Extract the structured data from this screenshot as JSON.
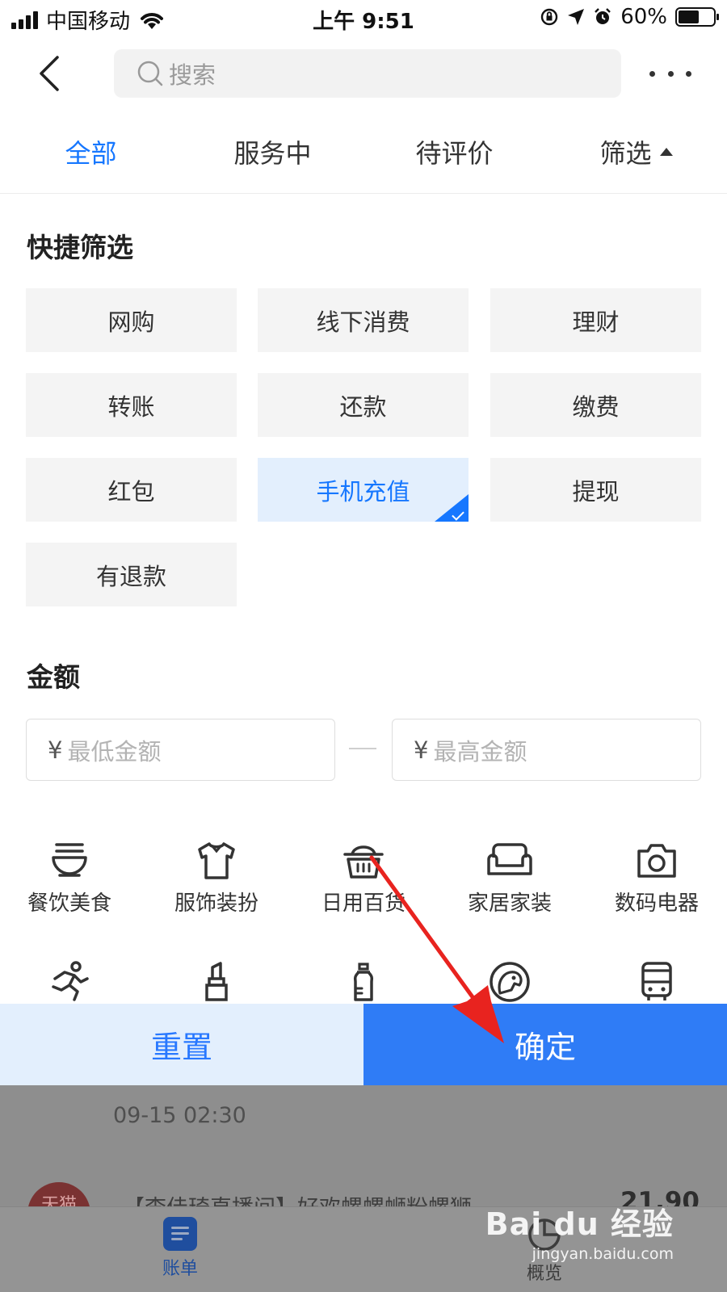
{
  "status_bar": {
    "carrier": "中国移动",
    "time": "上午 9:51",
    "battery": "60%",
    "battery_level": 0.6
  },
  "nav": {
    "search_placeholder": "搜索"
  },
  "tabs": [
    {
      "label": "全部",
      "active": true
    },
    {
      "label": "服务中",
      "active": false
    },
    {
      "label": "待评价",
      "active": false
    },
    {
      "label": "筛选",
      "active": false
    }
  ],
  "quick_filter": {
    "title": "快捷筛选",
    "options": [
      {
        "label": "网购",
        "selected": false
      },
      {
        "label": "线下消费",
        "selected": false
      },
      {
        "label": "理财",
        "selected": false
      },
      {
        "label": "转账",
        "selected": false
      },
      {
        "label": "还款",
        "selected": false
      },
      {
        "label": "缴费",
        "selected": false
      },
      {
        "label": "红包",
        "selected": false
      },
      {
        "label": "手机充值",
        "selected": true
      },
      {
        "label": "提现",
        "selected": false
      },
      {
        "label": "有退款",
        "selected": false
      }
    ]
  },
  "amount": {
    "title": "金额",
    "currency": "¥",
    "min_placeholder": "最低金额",
    "max_placeholder": "最高金额"
  },
  "categories": [
    {
      "label": "餐饮美食",
      "icon": "bowl-icon"
    },
    {
      "label": "服饰装扮",
      "icon": "shirt-icon"
    },
    {
      "label": "日用百货",
      "icon": "basket-icon"
    },
    {
      "label": "家居家装",
      "icon": "sofa-icon"
    },
    {
      "label": "数码电器",
      "icon": "camera-icon"
    },
    {
      "label": "",
      "icon": "running-icon"
    },
    {
      "label": "",
      "icon": "lipstick-icon"
    },
    {
      "label": "",
      "icon": "baby-bottle-icon"
    },
    {
      "label": "",
      "icon": "pet-icon"
    },
    {
      "label": "",
      "icon": "bus-icon"
    }
  ],
  "actions": {
    "reset": "重置",
    "confirm": "确定"
  },
  "background_list": {
    "time": "09-15  02:30",
    "logo_text": "天猫",
    "item_title": "【李佳琦直播间】好欢螺螺蛳粉螺狮",
    "amount": "21.90"
  },
  "tabbar": {
    "bill": "账单",
    "overview": "概览"
  },
  "watermark": {
    "brand": "Bai du 经验",
    "url": "jingyan.baidu.com"
  },
  "colors": {
    "accent": "#1677ff",
    "confirm_bg": "#2f7cf6",
    "reset_bg": "#e3effd",
    "annotation_arrow": "#e8231f"
  }
}
